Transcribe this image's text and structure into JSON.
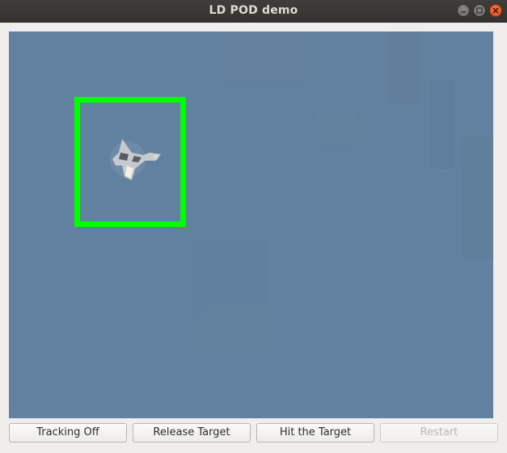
{
  "window": {
    "title": "LD POD demo"
  },
  "video": {
    "sky_color": "#62809f",
    "tracking_box_color": "#00ff00",
    "target_icon": "aircraft-icon"
  },
  "controls": {
    "tracking_label": "Tracking Off",
    "release_label": "Release Target",
    "hit_label": "Hit the Target",
    "restart_label": "Restart",
    "restart_enabled": false
  }
}
